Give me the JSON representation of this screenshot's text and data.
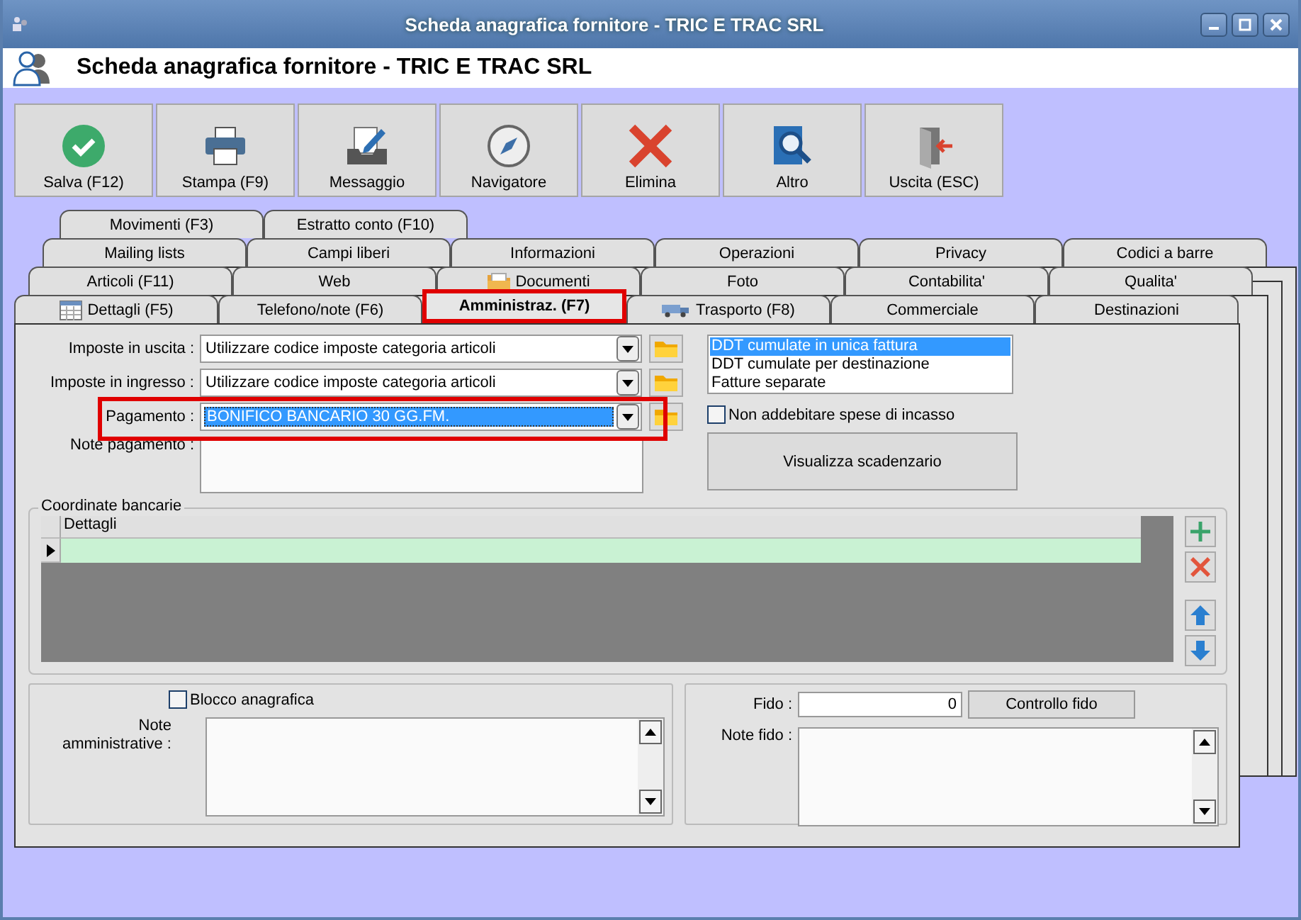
{
  "window": {
    "title": "Scheda anagrafica fornitore - TRIC E TRAC SRL"
  },
  "header": {
    "title": "Scheda anagrafica fornitore - TRIC E TRAC SRL"
  },
  "toolbar": [
    {
      "label": "Salva (F12)",
      "kind": "check"
    },
    {
      "label": "Stampa (F9)",
      "kind": "printer"
    },
    {
      "label": "Messaggio",
      "kind": "message"
    },
    {
      "label": "Navigatore",
      "kind": "compass"
    },
    {
      "label": "Elimina",
      "kind": "delete"
    },
    {
      "label": "Altro",
      "kind": "search"
    },
    {
      "label": "Uscita (ESC)",
      "kind": "exit"
    }
  ],
  "tab_rows": [
    [
      {
        "label": "Movimenti (F3)",
        "kind": "plain",
        "selected": false,
        "highlighted": false
      },
      {
        "label": "Estratto conto (F10)",
        "kind": "plain",
        "selected": false,
        "highlighted": false
      }
    ],
    [
      {
        "label": "Mailing lists",
        "kind": "plain",
        "selected": false,
        "highlighted": false
      },
      {
        "label": "Campi liberi",
        "kind": "plain",
        "selected": false,
        "highlighted": false
      },
      {
        "label": "Informazioni",
        "kind": "plain",
        "selected": false,
        "highlighted": false
      },
      {
        "label": "Operazioni",
        "kind": "plain",
        "selected": false,
        "highlighted": false
      },
      {
        "label": "Privacy",
        "kind": "plain",
        "selected": false,
        "highlighted": false
      },
      {
        "label": "Codici a barre",
        "kind": "plain",
        "selected": false,
        "highlighted": false
      }
    ],
    [
      {
        "label": "Articoli (F11)",
        "kind": "plain",
        "selected": false,
        "highlighted": false
      },
      {
        "label": "Web",
        "kind": "plain",
        "selected": false,
        "highlighted": false
      },
      {
        "label": "Documenti",
        "kind": "folder",
        "selected": false,
        "highlighted": false
      },
      {
        "label": "Foto",
        "kind": "plain",
        "selected": false,
        "highlighted": false
      },
      {
        "label": "Contabilita'",
        "kind": "plain",
        "selected": false,
        "highlighted": false
      },
      {
        "label": "Qualita'",
        "kind": "plain",
        "selected": false,
        "highlighted": false
      }
    ],
    [
      {
        "label": "Dettagli (F5)",
        "kind": "calendar",
        "selected": false,
        "highlighted": false
      },
      {
        "label": "Telefono/note (F6)",
        "kind": "plain",
        "selected": false,
        "highlighted": false
      },
      {
        "label": "Amministraz. (F7)",
        "kind": "plain",
        "selected": true,
        "highlighted": true
      },
      {
        "label": "Trasporto (F8)",
        "kind": "truck",
        "selected": false,
        "highlighted": false
      },
      {
        "label": "Commerciale",
        "kind": "plain",
        "selected": false,
        "highlighted": false
      },
      {
        "label": "Destinazioni",
        "kind": "plain",
        "selected": false,
        "highlighted": false
      }
    ]
  ],
  "fields": [
    {
      "label": "Imposte in uscita :",
      "value": "Utilizzare codice imposte categoria articoli",
      "selected": false,
      "highlighted": false
    },
    {
      "label": "Imposte in ingresso :",
      "value": "Utilizzare codice imposte categoria articoli",
      "selected": false,
      "highlighted": false
    },
    {
      "label": "Pagamento :",
      "value": "BONIFICO BANCARIO 30 GG.FM.",
      "selected": true,
      "highlighted": true
    }
  ],
  "note_pagamento": {
    "label": "Note pagamento :"
  },
  "invoicing_options": [
    {
      "label": "DDT cumulate in unica fattura",
      "selected": true
    },
    {
      "label": "DDT cumulate per destinazione",
      "selected": false
    },
    {
      "label": "Fatture separate",
      "selected": false
    }
  ],
  "no_charge_checkbox": {
    "label": "Non addebitare spese di incasso",
    "checked": false
  },
  "scadenzario_button": "Visualizza scadenzario",
  "bank": {
    "title": "Coordinate bancarie",
    "columns": [
      "Dettagli"
    ],
    "rows": [
      {
        "current": true
      }
    ]
  },
  "blocco_checkbox": {
    "label": "Blocco anagrafica",
    "checked": false
  },
  "note_amministrative": {
    "label": "Note amministrative :"
  },
  "fido": {
    "label": "Fido :",
    "value": "0",
    "button": "Controllo fido"
  },
  "note_fido": {
    "label": "Note fido :"
  }
}
